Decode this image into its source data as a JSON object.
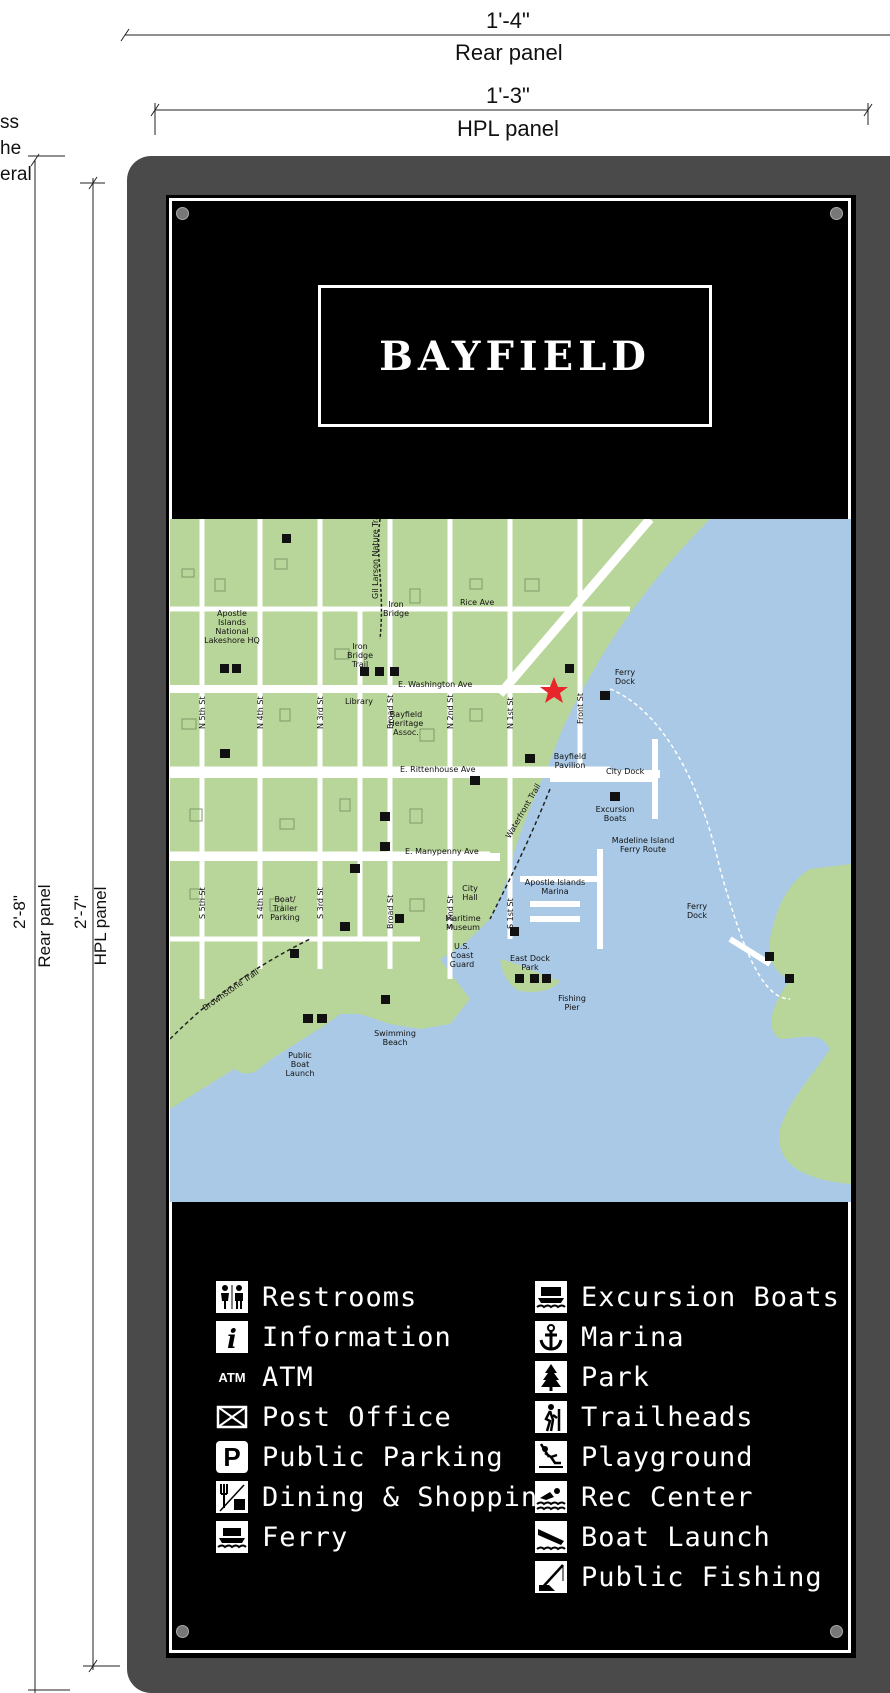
{
  "dimensions": {
    "rear_width": "1'-4\"",
    "rear_label": "Rear panel",
    "hpl_width": "1'-3\"",
    "hpl_label": "HPL panel",
    "rear_height": "2'-8\"",
    "rear_height_label": "Rear panel",
    "hpl_height": "2'-7\"",
    "hpl_height_label": "HPL panel",
    "cut_note": [
      "ss",
      "he",
      "eral"
    ]
  },
  "sign": {
    "title": "BAYFIELD"
  },
  "map": {
    "labels": {
      "apostle": [
        "Apostle",
        "Islands",
        "National",
        "Lakeshore HQ"
      ],
      "iron_bridge_trail": [
        "Iron",
        "Bridge",
        "Trail"
      ],
      "iron_bridge": [
        "Iron",
        "Bridge"
      ],
      "gil_larson": "Gil Larson Nature Trail",
      "rice_ave": "Rice Ave",
      "washington": "E. Washington Ave",
      "library": "Library",
      "heritage": [
        "Bayfield",
        "Heritage",
        "Assoc."
      ],
      "ferry_dock": [
        "Ferry",
        "Dock"
      ],
      "rittenhouse": "E. Rittenhouse Ave",
      "pavilion": [
        "Bayfield",
        "Pavilion"
      ],
      "city_dock": "City Dock",
      "excursion": [
        "Excursion",
        "Boats"
      ],
      "madeline": [
        "Madeline Island",
        "Ferry Route"
      ],
      "manypenny": "E. Manypenny Ave",
      "waterfront": "Waterfront Trail",
      "marina": [
        "Apostle Islands",
        "Marina"
      ],
      "ferry_dock_2": [
        "Ferry",
        "Dock"
      ],
      "boat_trailer": [
        "Boat/",
        "Trailer",
        "Parking"
      ],
      "city_hall": [
        "City",
        "Hall"
      ],
      "maritime": [
        "Maritime",
        "Museum"
      ],
      "coast_guard": [
        "U.S.",
        "Coast",
        "Guard"
      ],
      "east_dock": [
        "East Dock",
        "Park"
      ],
      "fishing_pier": [
        "Fishing",
        "Pier"
      ],
      "brownstone": "Brownstone Trail",
      "swimming": [
        "Swimming",
        "Beach"
      ],
      "public_boat": [
        "Public",
        "Boat",
        "Launch"
      ],
      "streets": [
        "N 5th St",
        "N 4th St",
        "N 3rd St",
        "Broad St",
        "N 2nd St",
        "N 1st St",
        "Front St",
        "S 5th St",
        "S 4th St",
        "S 3rd St",
        "Broad St",
        "S 2nd St",
        "S 1st St"
      ],
      "atm": "ATM"
    }
  },
  "legend": {
    "left": [
      {
        "icon": "restrooms-icon",
        "label": "Restrooms"
      },
      {
        "icon": "information-icon",
        "label": "Information"
      },
      {
        "icon": "atm-icon",
        "label": "ATM",
        "icon_text": "ATM"
      },
      {
        "icon": "post-office-icon",
        "label": "Post Office"
      },
      {
        "icon": "parking-icon",
        "label": "Public Parking",
        "icon_text": "P"
      },
      {
        "icon": "dining-shopping-icon",
        "label": "Dining & Shopping"
      },
      {
        "icon": "ferry-icon",
        "label": "Ferry"
      }
    ],
    "right": [
      {
        "icon": "excursion-boats-icon",
        "label": "Excursion Boats"
      },
      {
        "icon": "marina-icon",
        "label": "Marina"
      },
      {
        "icon": "park-icon",
        "label": "Park"
      },
      {
        "icon": "trailheads-icon",
        "label": "Trailheads"
      },
      {
        "icon": "playground-icon",
        "label": "Playground"
      },
      {
        "icon": "rec-center-icon",
        "label": "Rec Center"
      },
      {
        "icon": "boat-launch-icon",
        "label": "Boat Launch"
      },
      {
        "icon": "public-fishing-icon",
        "label": "Public Fishing"
      }
    ]
  },
  "colors": {
    "panel": "#4a4a4a",
    "land": "#b9d69a",
    "water": "#a9c9e6",
    "street": "#ffffff",
    "marker": "#e8252b"
  }
}
